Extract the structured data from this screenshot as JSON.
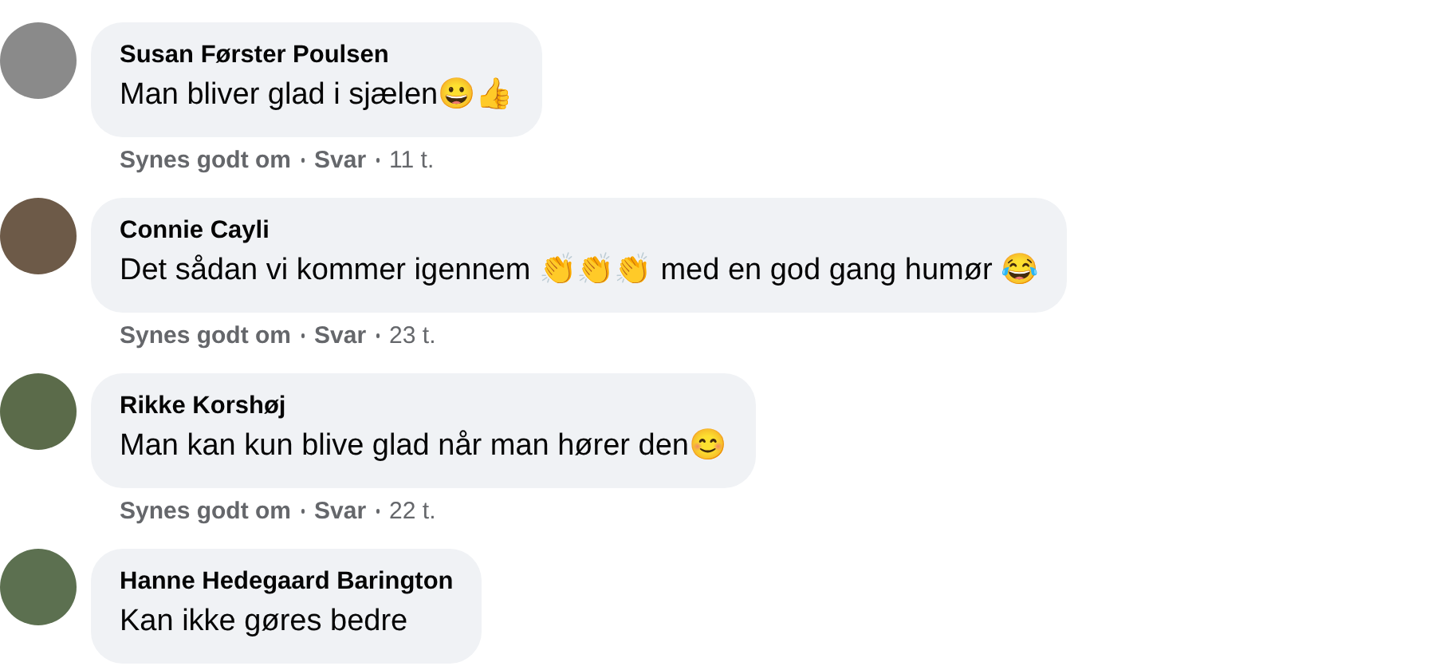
{
  "comments": [
    {
      "author": "Susan Førster Poulsen",
      "text": "Man bliver glad i sjælen😀👍",
      "like": "Synes godt om",
      "reply": "Svar",
      "time": "11 t."
    },
    {
      "author": "Connie Cayli",
      "text": "Det sådan vi kommer igennem 👏👏👏 med en god gang humør 😂",
      "like": "Synes godt om",
      "reply": "Svar",
      "time": "23 t."
    },
    {
      "author": "Rikke Korshøj",
      "text": "Man kan kun blive glad når man hører den😊",
      "like": "Synes godt om",
      "reply": "Svar",
      "time": "22 t."
    },
    {
      "author": "Hanne Hedegaard Barington",
      "text": "Kan ikke gøres bedre"
    }
  ]
}
